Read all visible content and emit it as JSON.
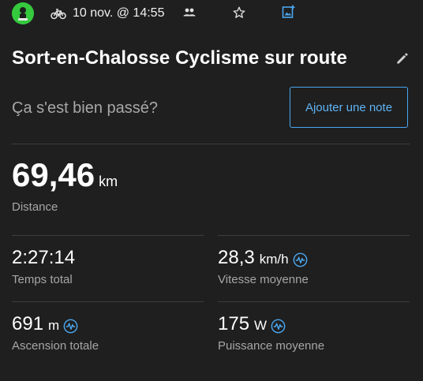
{
  "header": {
    "activity_icon": "bike-icon",
    "datetime": "10 nov. @ 14:55",
    "icons": [
      "avatar-icon",
      "group-icon",
      "star-icon",
      "add-photo-icon"
    ]
  },
  "activity": {
    "title": "Sort-en-Chalosse Cyclisme sur route",
    "edit_icon": "pencil-icon"
  },
  "note": {
    "question": "Ça s'est bien passé?",
    "button_label": "Ajouter une note"
  },
  "distance": {
    "value": "69,46",
    "unit": "km",
    "label": "Distance"
  },
  "stats": {
    "total_time": {
      "value": "2:27:14",
      "label": "Temps total"
    },
    "avg_speed": {
      "value": "28,3",
      "unit": "km/h",
      "label": "Vitesse moyenne"
    },
    "ascent": {
      "value": "691",
      "unit": "m",
      "label": "Ascension totale"
    },
    "avg_power": {
      "value": "175",
      "unit": "W",
      "label": "Puissance moyenne"
    }
  },
  "colors": {
    "background": "#1f1f1f",
    "accent": "#4aa7f0",
    "avatar": "#35c93e",
    "divider": "#3d3d3d"
  }
}
